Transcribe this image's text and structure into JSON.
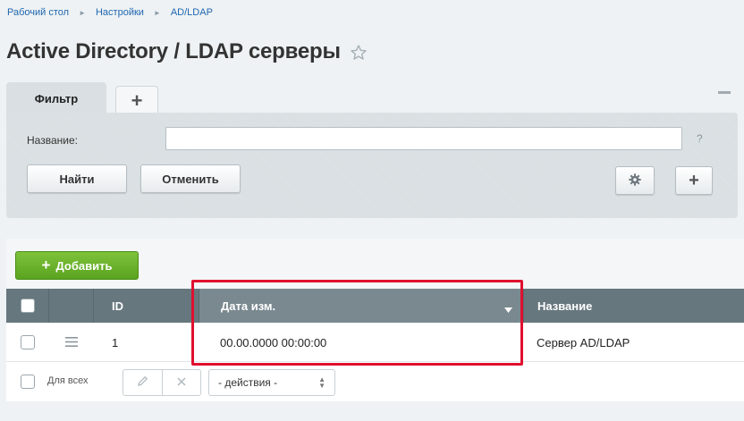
{
  "breadcrumb": {
    "items": [
      "Рабочий стол",
      "Настройки",
      "AD/LDAP"
    ]
  },
  "page": {
    "title": "Active Directory / LDAP серверы"
  },
  "filter": {
    "tab_label": "Фильтр",
    "add_tab_symbol": "+",
    "name_label": "Название:",
    "name_value": "",
    "help_symbol": "?",
    "find_label": "Найти",
    "cancel_label": "Отменить",
    "plus_symbol": "+"
  },
  "grid": {
    "add_label": "Добавить",
    "add_symbol": "+",
    "columns": {
      "id": "ID",
      "date": "Дата изм.",
      "name": "Название"
    },
    "rows": [
      {
        "id": "1",
        "date": "00.00.0000 00:00:00",
        "name": "Сервер AD/LDAP"
      }
    ],
    "footer": {
      "for_all_label": "Для всех",
      "actions_value": "- действия -"
    }
  },
  "colors": {
    "accent_green": "#5aa41f",
    "header_bg": "#67777e",
    "highlight": "#e0102f",
    "link": "#2067b0"
  }
}
